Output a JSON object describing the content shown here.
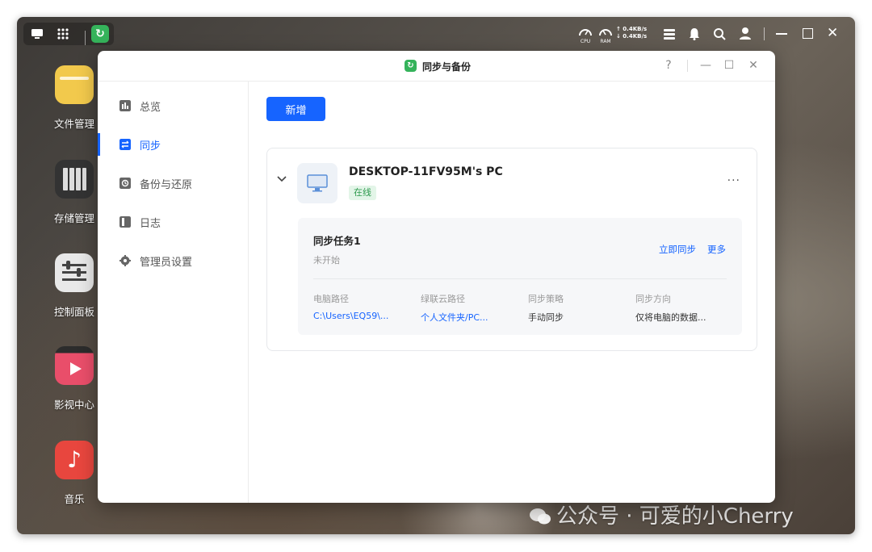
{
  "topbar": {
    "icons": [
      "desktop-icon",
      "apps-grid-icon",
      "sync-app-icon"
    ],
    "right_icons": [
      "cpu-gauge-icon",
      "ram-gauge-icon",
      "task-list-icon",
      "bell-icon",
      "search-icon",
      "user-icon",
      "minimize-icon",
      "maximize-icon",
      "close-icon"
    ],
    "cpu_label": "CPU",
    "ram_label": "RAM",
    "upload_speed": "↑ 0.4KB/s",
    "download_speed": "↓ 0.4KB/s"
  },
  "desktop": {
    "apps": [
      {
        "label": "文件管理",
        "icon": "folder-icon",
        "color": "#f2c94c"
      },
      {
        "label": "存储管理",
        "icon": "storage-icon",
        "color": "#3a3a3a"
      },
      {
        "label": "控制面板",
        "icon": "control-panel-icon",
        "color": "#e6e6e6"
      },
      {
        "label": "影视中心",
        "icon": "video-icon",
        "color": "#e94e6a"
      },
      {
        "label": "音乐",
        "icon": "music-icon",
        "color": "#e8463e"
      }
    ]
  },
  "watermark": "公众号 · 可爱的小Cherry",
  "window": {
    "title": "同步与备份",
    "controls": {
      "help": "?",
      "minimize": "—",
      "maximize": "☐",
      "close": "✕"
    },
    "sidebar": {
      "items": [
        {
          "label": "总览",
          "icon": "overview-icon",
          "active": false
        },
        {
          "label": "同步",
          "icon": "sync-icon",
          "active": true
        },
        {
          "label": "备份与还原",
          "icon": "backup-icon",
          "active": false
        },
        {
          "label": "日志",
          "icon": "log-icon",
          "active": false
        },
        {
          "label": "管理员设置",
          "icon": "gear-icon",
          "active": false
        }
      ]
    },
    "main": {
      "new_button": "新增",
      "device": {
        "name": "DESKTOP-11FV95M's PC",
        "status": "在线",
        "more": "···",
        "task": {
          "name": "同步任务1",
          "state": "未开始",
          "sync_now": "立即同步",
          "more": "更多",
          "fields": [
            {
              "key": "电脑路径",
              "value": "C:\\Users\\EQ59\\..."
            },
            {
              "key": "绿联云路径",
              "value": "个人文件夹/PC..."
            },
            {
              "key": "同步策略",
              "value": "手动同步"
            },
            {
              "key": "同步方向",
              "value": "仅将电脑的数据..."
            }
          ]
        }
      }
    }
  },
  "colors": {
    "accent": "#1664ff",
    "online_bg": "#e3f5e8",
    "online_text": "#2e9a4e",
    "app_green": "#35b35b"
  }
}
